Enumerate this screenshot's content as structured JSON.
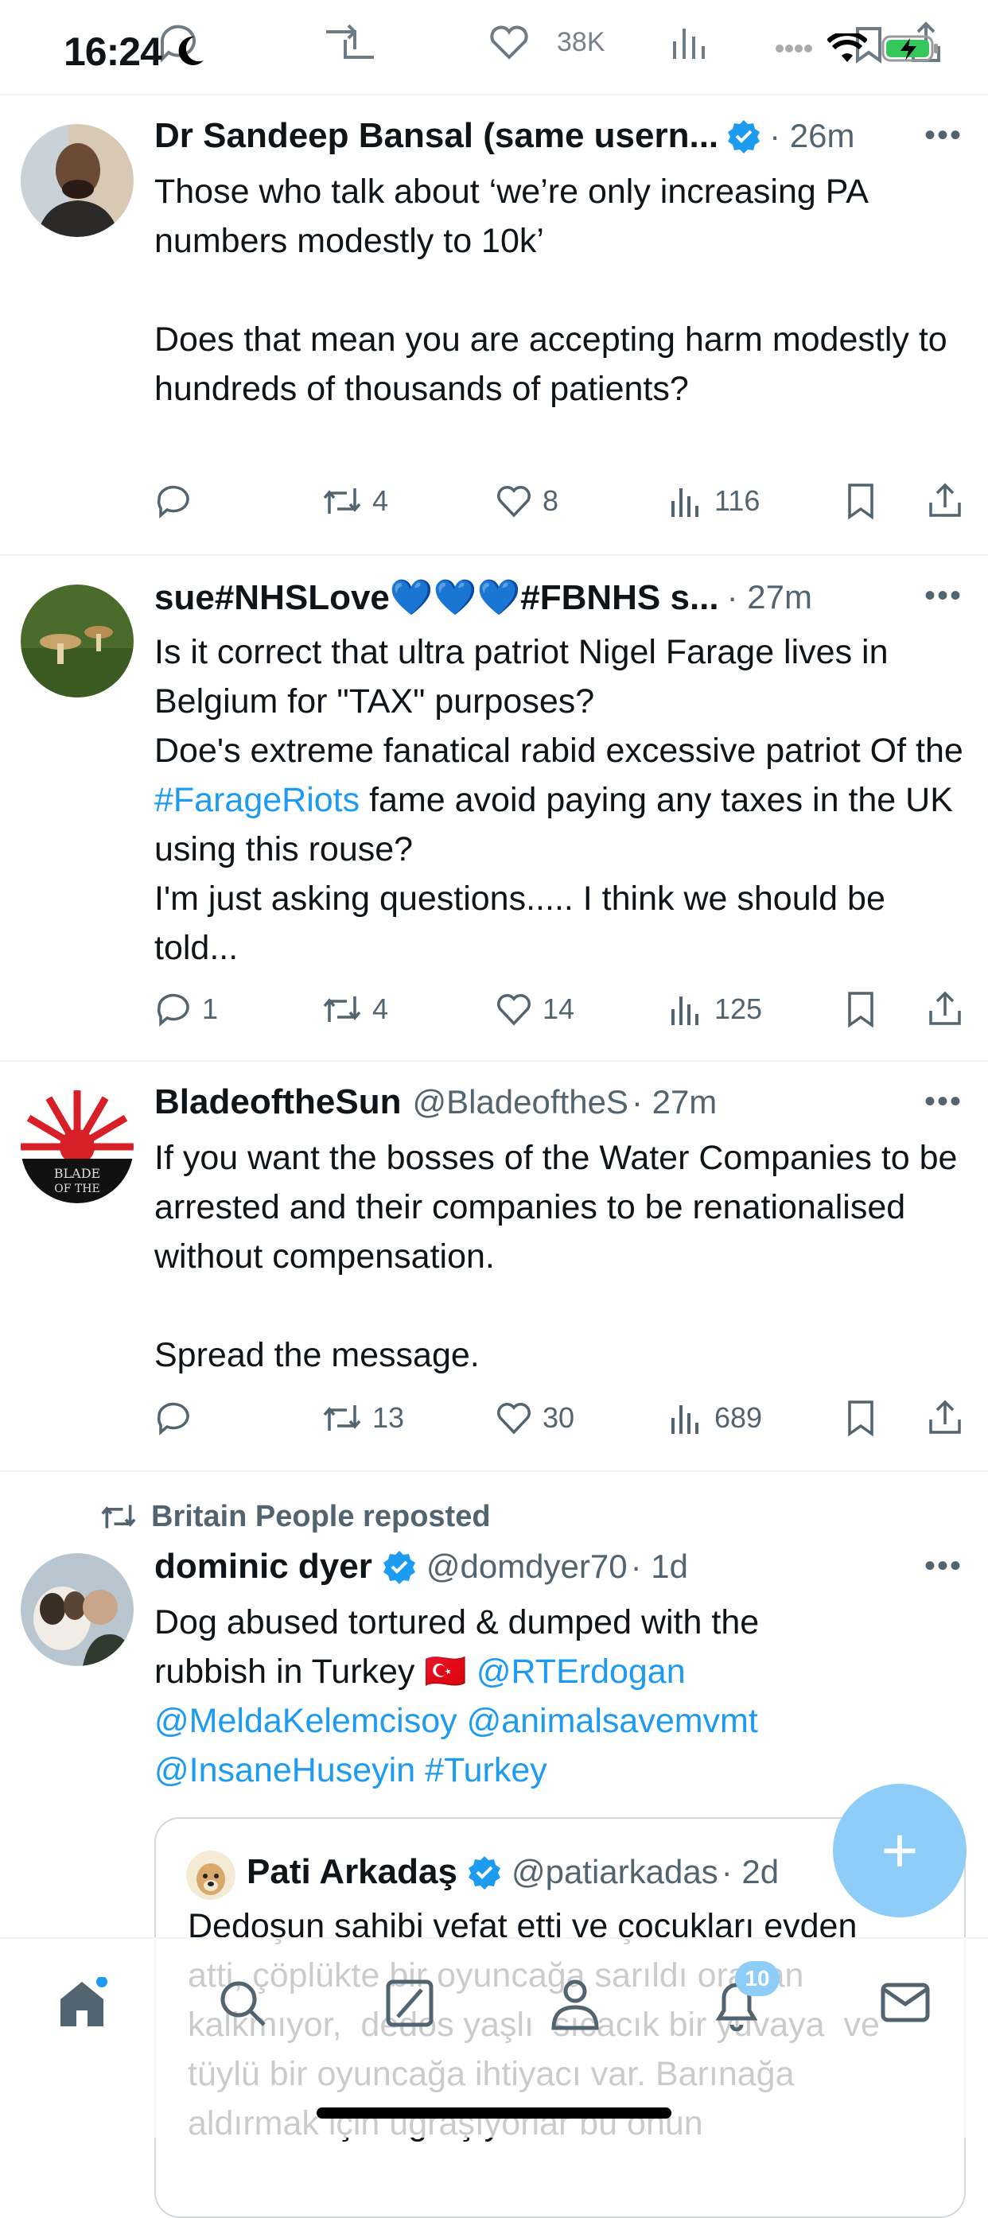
{
  "status_bar": {
    "time": "16:24",
    "ghost_views": "38K"
  },
  "tweets": [
    {
      "name": "Dr Sandeep Bansal (same usern...",
      "verified": true,
      "time": "· 26m",
      "body": "Those who talk about ‘we’re only increasing PA numbers modestly to 10k’\n\nDoes that mean you are accepting harm modestly to hundreds of thousands of patients?",
      "replies": "",
      "reposts": "4",
      "likes": "8",
      "views": "116"
    },
    {
      "name": "sue#NHSLove💙💙💙#FBNHS s...",
      "time": "· 27m",
      "body_pre": "Is it correct that ultra patriot Nigel Farage lives in Belgium for \"TAX\" purposes?\nDoe's extreme fanatical rabid excessive patriot Of the ",
      "body_link": "#FarageRiots",
      "body_post": " fame avoid paying any taxes in the UK using this rouse?\nI'm just asking questions..... I think we should be told...",
      "replies": "1",
      "reposts": "4",
      "likes": "14",
      "views": "125"
    },
    {
      "name": "BladeoftheSun",
      "handle": "@BladeoftheS",
      "time": "· 27m",
      "body": "If you want the bosses of the Water Companies to be arrested and their companies to be renationalised without compensation.\n\nSpread the message.",
      "replies": "",
      "reposts": "13",
      "likes": "30",
      "views": "689"
    },
    {
      "repost_label": "Britain People reposted",
      "name": "dominic dyer",
      "verified": true,
      "handle": "@domdyer70",
      "time": "· 1d",
      "body_line1": "Dog abused tortured & dumped with the",
      "body_line2_pre": "rubbish in Turkey 🇹🇷 ",
      "mention1": "@RTErdogan",
      "mention2": "@MeldaKelemcisoy",
      "mention3": "@animalsavemvmt",
      "mention4": "@InsaneHuseyin",
      "hashtag": "#Turkey",
      "quote": {
        "name": "Pati Arkadaş",
        "verified": true,
        "handle": "@patiarkadas",
        "time": "· 2d",
        "body": "Dedoşun sahibi vefat etti ve çocukları evden atti, çöplükte bir oyuncağa sarıldı oradan kalkmıyor,  dedos yaşlı  sıcacık bir yuvaya  ve tüylü bir oyuncağa ihtiyacı var. Barınağa aldırmak için uğraşıyorlar bu onun"
      }
    }
  ],
  "nav": {
    "notifications_badge": "10",
    "items": [
      "home-icon",
      "search-icon",
      "grok-icon",
      "communities-icon",
      "notifications-icon",
      "messages-icon"
    ]
  },
  "compose_button": "+",
  "colors": {
    "accent": "#1d9bf0",
    "fab": "#8ecdf7",
    "muted": "#536471"
  }
}
